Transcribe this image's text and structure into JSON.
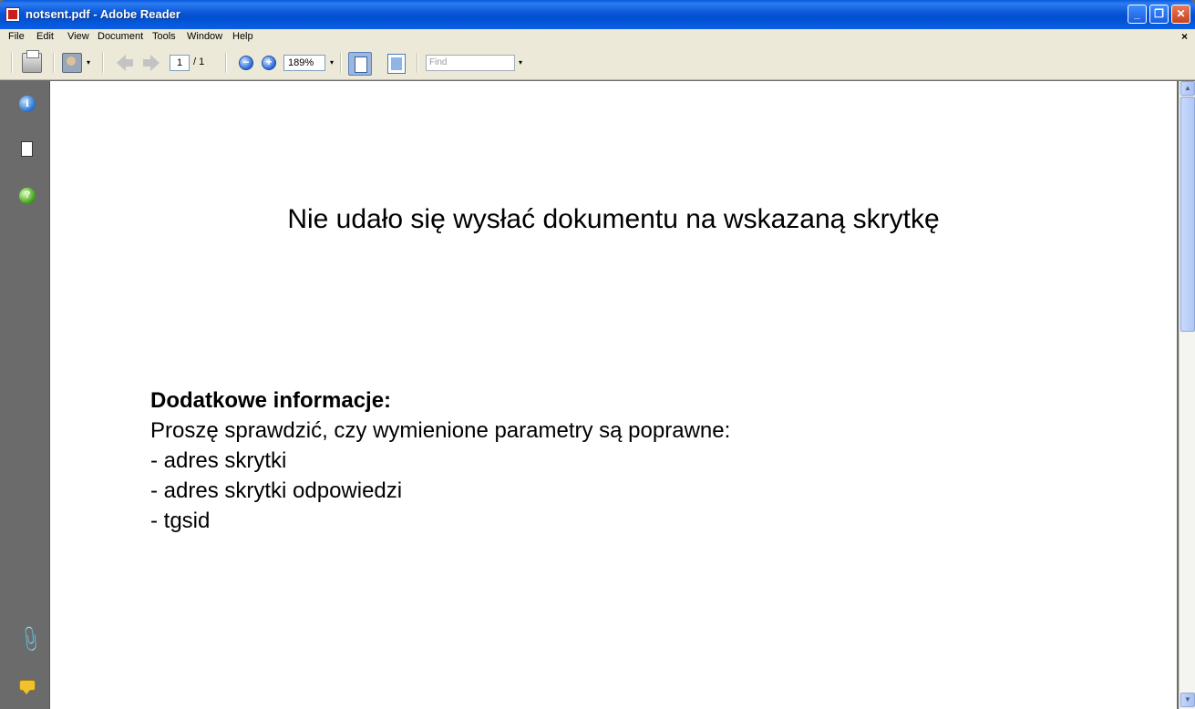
{
  "window": {
    "title": "notsent.pdf - Adobe Reader",
    "minimize": "_",
    "restore": "❐",
    "close": "✕"
  },
  "menu": {
    "items": [
      "File",
      "Edit",
      "View",
      "Document",
      "Tools",
      "Window",
      "Help"
    ],
    "close_doc": "×"
  },
  "toolbar": {
    "current_page": "1",
    "page_total": "/ 1",
    "zoom_out": "−",
    "zoom_in": "+",
    "zoom_level": "189%",
    "find_placeholder": "Find",
    "dropdown_arrow": "▾"
  },
  "nav": {
    "info_glyph": "i",
    "help_glyph": "?",
    "clip_glyph": "📎"
  },
  "document": {
    "heading": "Nie udało się wysłać dokumentu na wskazaną skrytkę",
    "subheading": "Dodatkowe informacje:",
    "lines": [
      "Proszę sprawdzić, czy wymienione parametry są poprawne:",
      "- adres skrytki",
      "- adres skrytki odpowiedzi",
      "- tgsid"
    ]
  },
  "scrollbar": {
    "up": "▲",
    "down": "▼"
  }
}
